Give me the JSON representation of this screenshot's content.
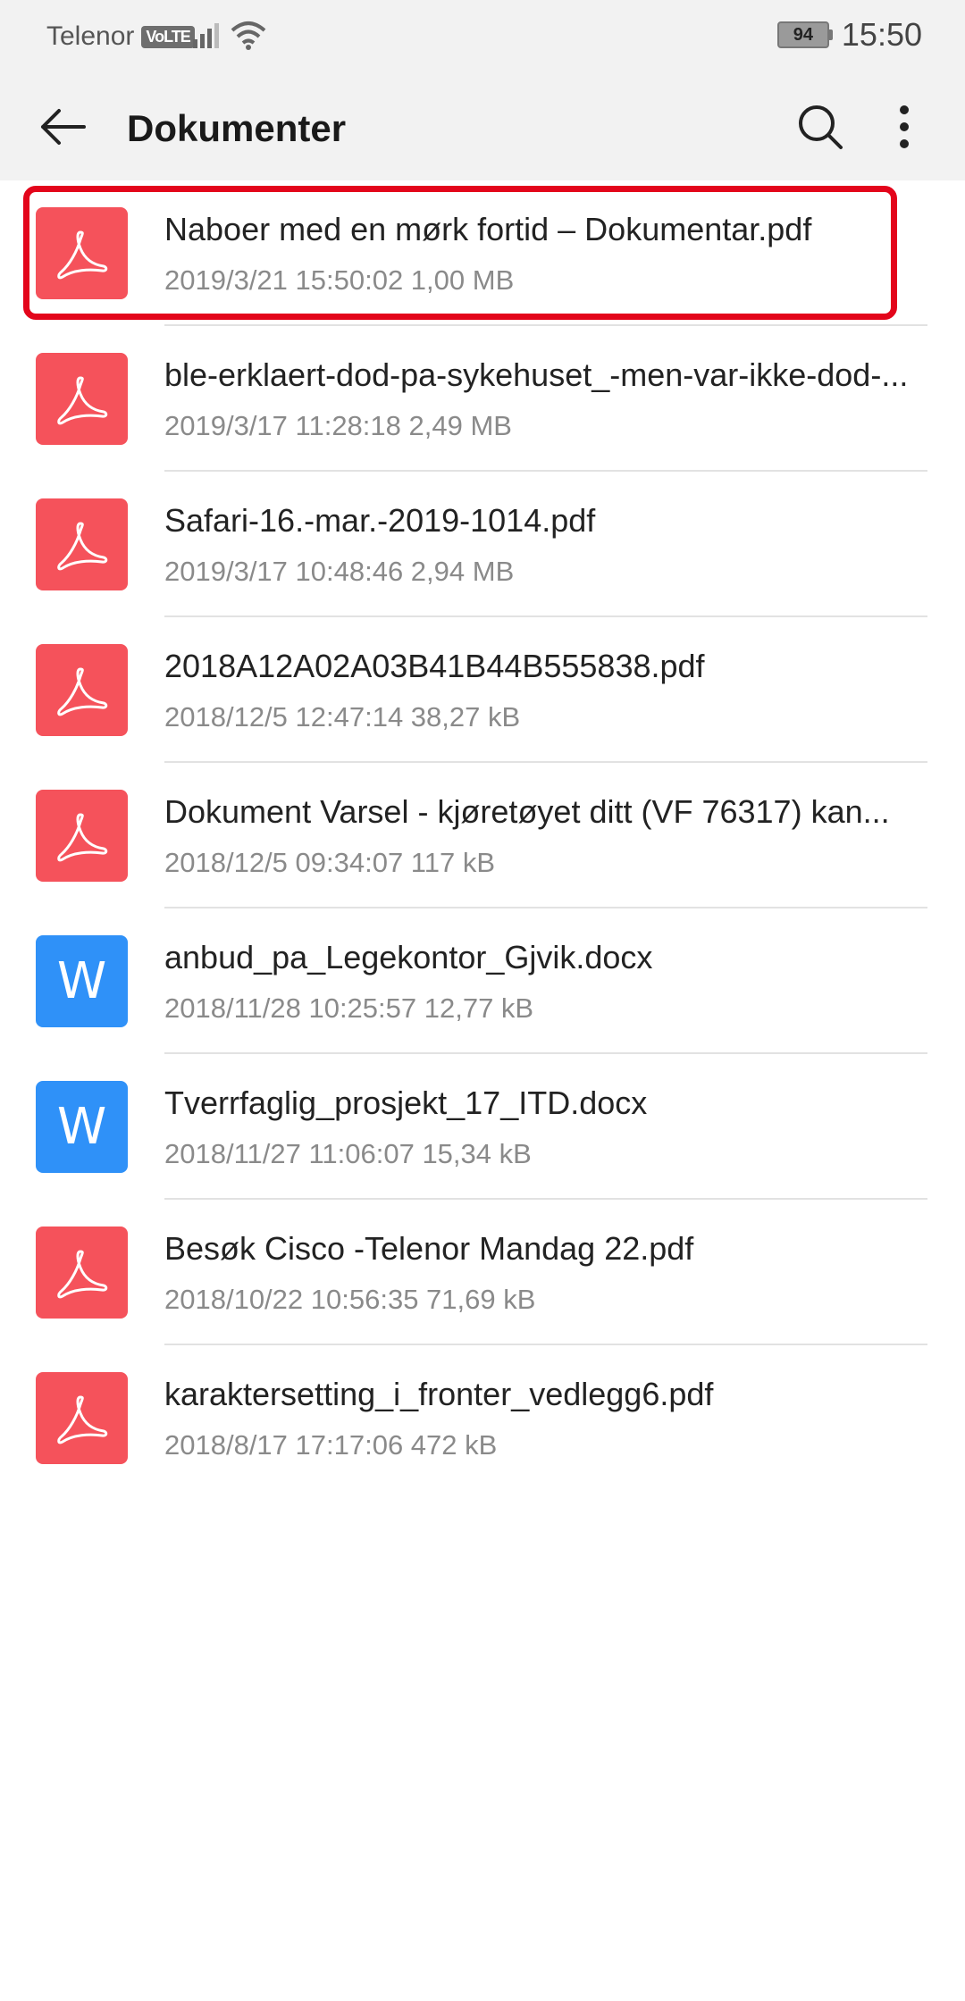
{
  "status_bar": {
    "carrier": "Telenor",
    "volte": "VoLTE",
    "battery": "94",
    "time": "15:50"
  },
  "app_bar": {
    "title": "Dokumenter",
    "icons": [
      "back-arrow-icon",
      "search-icon",
      "more-vert-icon"
    ]
  },
  "files": [
    {
      "name": "Naboer med en mørk fortid – Dokumentar.pdf",
      "meta": "2019/3/21 15:50:02 1,00 MB",
      "type": "pdf",
      "selected": true
    },
    {
      "name": "ble-erklaert-dod-pa-sykehuset_-men-var-ikke-dod-...",
      "meta": "2019/3/17 11:28:18 2,49 MB",
      "type": "pdf"
    },
    {
      "name": "Safari-16.-mar.-2019-1014.pdf",
      "meta": "2019/3/17 10:48:46 2,94 MB",
      "type": "pdf"
    },
    {
      "name": "2018A12A02A03B41B44B555838.pdf",
      "meta": "2018/12/5 12:47:14 38,27 kB",
      "type": "pdf"
    },
    {
      "name": "Dokument Varsel - kjøretøyet ditt (VF 76317) kan...",
      "meta": "2018/12/5 09:34:07 117 kB",
      "type": "pdf"
    },
    {
      "name": "anbud_pa_Legekontor_Gjvik.docx",
      "meta": "2018/11/28 10:25:57 12,77 kB",
      "type": "docx",
      "icon_letter": "W"
    },
    {
      "name": "Tverrfaglig_prosjekt_17_ITD.docx",
      "meta": "2018/11/27 11:06:07 15,34 kB",
      "type": "docx",
      "icon_letter": "W"
    },
    {
      "name": "Besøk Cisco -Telenor Mandag 22.pdf",
      "meta": "2018/10/22 10:56:35 71,69 kB",
      "type": "pdf"
    },
    {
      "name": "karaktersetting_i_fronter_vedlegg6.pdf",
      "meta": "2018/8/17 17:17:06 472 kB",
      "type": "pdf"
    }
  ],
  "colors": {
    "pdf_icon": "#f5525b",
    "docx_icon": "#2f91f8",
    "highlight": "#e3051b"
  }
}
